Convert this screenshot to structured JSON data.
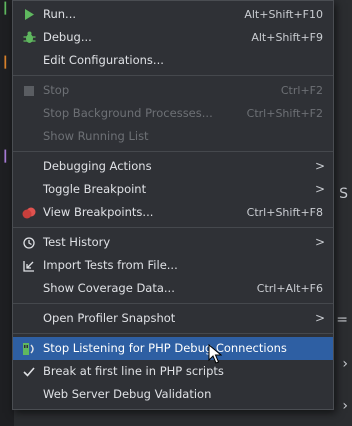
{
  "menu": {
    "items": [
      {
        "label": "Run...",
        "shortcut": "Alt+Shift+F10",
        "icon": "run-icon",
        "disabled": false
      },
      {
        "label": "Debug...",
        "shortcut": "Alt+Shift+F9",
        "icon": "debug-icon",
        "disabled": false
      },
      {
        "label": "Edit Configurations...",
        "shortcut": "",
        "icon": "",
        "disabled": false
      },
      {
        "label": "Stop",
        "shortcut": "Ctrl+F2",
        "icon": "stop-icon",
        "disabled": true
      },
      {
        "label": "Stop Background Processes...",
        "shortcut": "Ctrl+Shift+F2",
        "icon": "",
        "disabled": true
      },
      {
        "label": "Show Running List",
        "shortcut": "",
        "icon": "",
        "disabled": true
      },
      {
        "label": "Debugging Actions",
        "shortcut": "",
        "icon": "",
        "disabled": false,
        "submenu": true
      },
      {
        "label": "Toggle Breakpoint",
        "shortcut": "",
        "icon": "",
        "disabled": false,
        "submenu": true
      },
      {
        "label": "View Breakpoints...",
        "shortcut": "Ctrl+Shift+F8",
        "icon": "breakpoints-icon",
        "disabled": false
      },
      {
        "label": "Test History",
        "shortcut": "",
        "icon": "clock-icon",
        "disabled": false,
        "submenu": true
      },
      {
        "label": "Import Tests from File...",
        "shortcut": "",
        "icon": "import-icon",
        "disabled": false
      },
      {
        "label": "Show Coverage Data...",
        "shortcut": "Ctrl+Alt+F6",
        "icon": "",
        "disabled": false
      },
      {
        "label": "Open Profiler Snapshot",
        "shortcut": "",
        "icon": "",
        "disabled": false,
        "submenu": true
      },
      {
        "label": "Stop Listening for PHP Debug Connections",
        "shortcut": "",
        "icon": "php-listen-icon",
        "disabled": false,
        "selected": true
      },
      {
        "label": "Break at first line in PHP scripts",
        "shortcut": "",
        "icon": "check-icon",
        "disabled": false
      },
      {
        "label": "Web Server Debug Validation",
        "shortcut": "",
        "icon": "",
        "disabled": false
      }
    ],
    "submenu_glyph": ">"
  },
  "colors": {
    "menu_bg": "#2f3136",
    "selected_bg": "#2e5fa3",
    "text": "#dfe1e5",
    "disabled_text": "#6d7075",
    "run_green": "#5fb85f",
    "breakpoint_red": "#e0524f"
  }
}
